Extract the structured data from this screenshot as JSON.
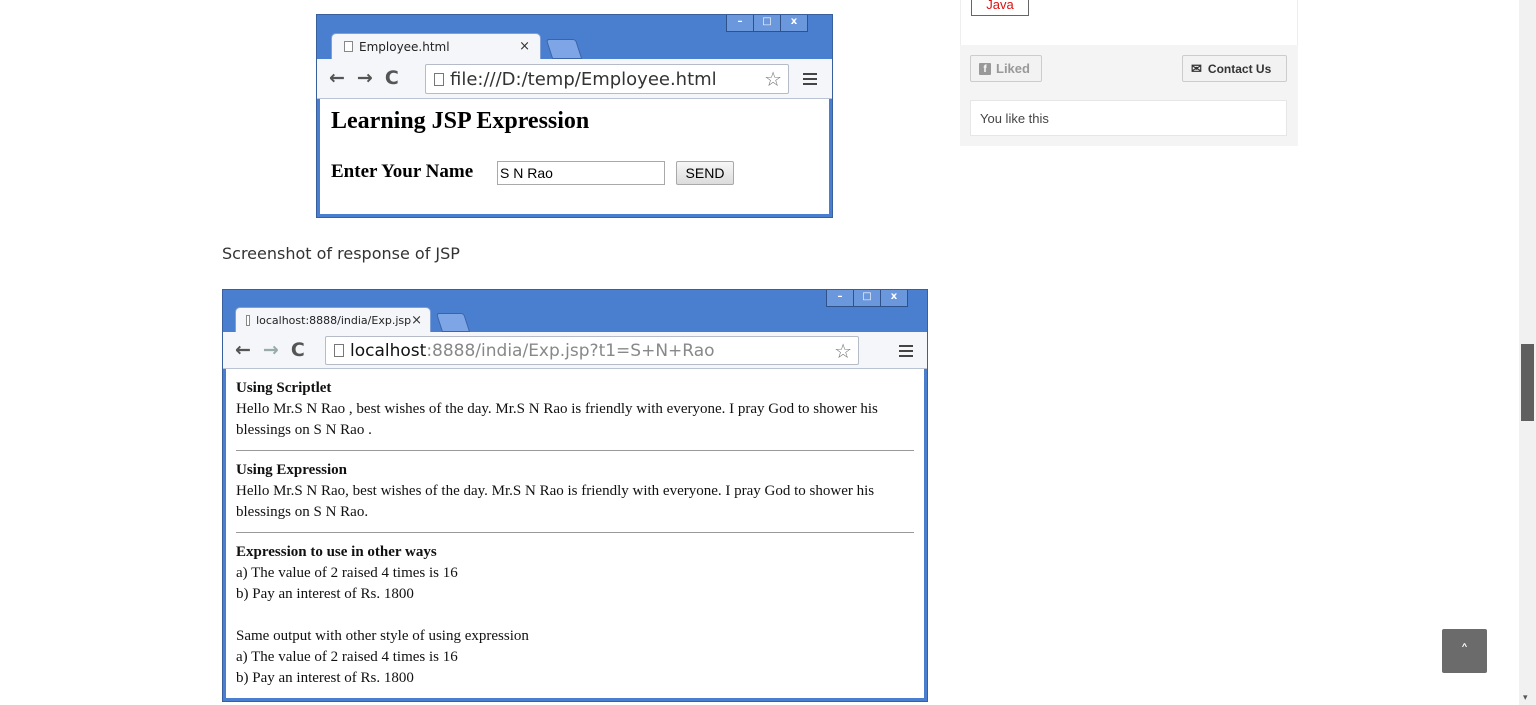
{
  "window1": {
    "tab_title": "Employee.html",
    "tab_close": "×",
    "url": "file:///D:/temp/Employee.html",
    "heading": "Learning JSP Expression",
    "label": "Enter Your Name",
    "input_value": "S N Rao",
    "button": "SEND"
  },
  "caption": "Screenshot of response of JSP",
  "window2": {
    "tab_title": "localhost:8888/india/Exp.jsp",
    "tab_close": "×",
    "url_host": "localhost",
    "url_rest": ":8888/india/Exp.jsp?t1=S+N+Rao",
    "scriptlet_heading": "Using Scriptlet",
    "scriptlet_text": "Hello Mr.S N Rao , best wishes of the day. Mr.S N Rao is friendly with everyone. I pray God to shower his blessings on S N Rao .",
    "expression_heading": "Using Expression",
    "expression_text": "Hello Mr.S N Rao, best wishes of the day. Mr.S N Rao is friendly with everyone. I pray God to shower his blessings on S N Rao.",
    "other_heading": "Expression to use in other ways",
    "other_a": "a) The value of 2 raised 4 times is 16",
    "other_b": "b) Pay an interest of Rs. 1800",
    "same_output": "Same output with other style of using expression",
    "same_a": "a) The value of 2 raised 4 times is 16",
    "same_b": "b) Pay an interest of Rs. 1800"
  },
  "window_controls": {
    "minimize": "–",
    "maximize": "□",
    "close": "x"
  },
  "nav": {
    "back": "←",
    "forward": "→",
    "reload": "C",
    "star": "☆"
  },
  "sidebar": {
    "tag": "Java",
    "liked_label": "Liked",
    "facebook_glyph": "f",
    "contact_label": "Contact Us",
    "mail_glyph": "✉",
    "like_text": "You like this"
  },
  "back_to_top": "˄",
  "scroll_arrow": "▾"
}
